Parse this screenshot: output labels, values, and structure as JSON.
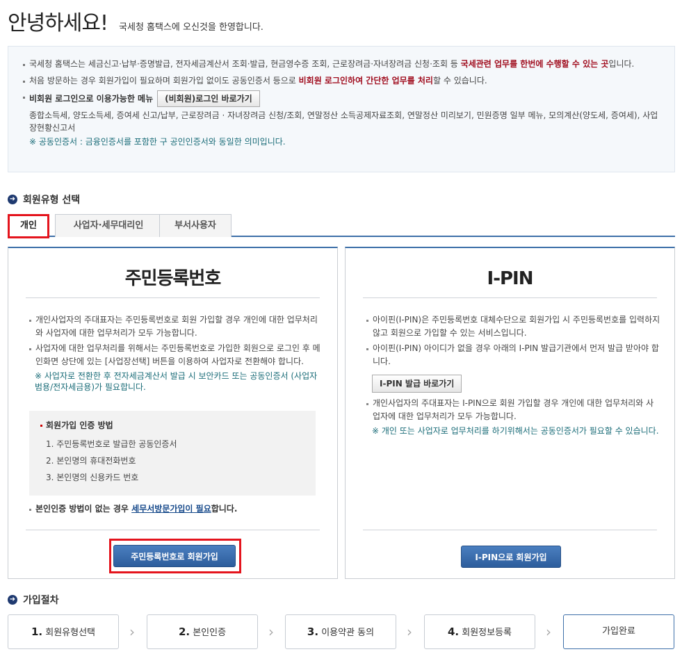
{
  "greeting": {
    "title": "안녕하세요!",
    "subtitle": "국세청 홈택스에 오신것을 한영합니다."
  },
  "info": {
    "line1_a": "국세청 홈택스는 세금신고·납부·증명발급, 전자세금계산서 조회·발급, 현금영수증 조회, 근로장려금·자녀장려금 신청·조회 등 ",
    "line1_b": "국세관련 업무를 한번에 수행할 수 있는 곳",
    "line1_c": "입니다.",
    "line2_a": "처음 방문하는 경우 회원가입이 필요하며 회원가입 없이도 공동인증서 등으로 ",
    "line2_b": "비회원 로그인하여 간단한 업무를 처리",
    "line2_c": "할 수 있습니다.",
    "menu_label": "비회원 로그인으로 이용가능한 메뉴",
    "menu_button": "(비회원)로그인 바로가기",
    "menu_list": "종합소득세, 양도소득세, 증여세 신고/납부, 근로장려금 · 자녀장려금 신청/조회, 연말정산 소득공제자료조회, 연말정산 미리보기, 민원증명 일부 메뉴, 모의계산(양도세, 증여세), 사업장현황신고서",
    "note": "※ 공동인증서 : 금융인증서를 포함한 구 공인인증서와 동일한 의미입니다."
  },
  "member_type": {
    "title": "회원유형 선택",
    "tabs": [
      "개인",
      "사업자·세무대리인",
      "부서사용자"
    ]
  },
  "left_card": {
    "title": "주민등록번호",
    "bullet1": "개인사업자의 주대표자는 주민등록번호로 회원 가입할 경우 개인에 대한 업무처리와 사업자에 대한 업무처리가 모두 가능합니다.",
    "bullet2": "사업자에 대한 업무처리를 위해서는 주민등록번호로 가입한 회원으로 로그인 후 메인화면 상단에 있는 [사업장선택] 버튼을 이용하여 사업자로 전환해야 합니다.",
    "note": "※ 사업자로 전환한 후 전자세금계산서 발급 시 보안카드 또는 공동인증서 (사업자범용/전자세금용)가 필요합니다.",
    "auth_title": "회원가입 인증 방법",
    "auth_items": [
      "1. 주민등록번호로 발급한 공동인증서",
      "2. 본인명의 휴대전화번호",
      "3. 본인명의 신용카드 번호"
    ],
    "bottom_a": "본인인증 방법이 없는 경우 ",
    "bottom_link": "세무서방문가입이 필요",
    "bottom_c": "합니다.",
    "button": "주민등록번호로 회원가입"
  },
  "right_card": {
    "title": "I-PIN",
    "bullet1": "아이핀(I-PIN)은 주민등록번호 대체수단으로 회원가입 시 주민등록번호를 입력하지 않고 회원으로 가입할 수 있는 서비스입니다.",
    "bullet2": "아이핀(I-PIN) 아이디가 없을 경우 아래의 I-PIN 발급기관에서 먼저 발급 받아야 합니다.",
    "issue_button": "I-PIN 발급 바로가기",
    "bullet3": "개인사업자의 주대표자는 I-PIN으로 회원 가입할 경우 개인에 대한 업무처리와 사업자에 대한 업무처리가 모두 가능합니다.",
    "note": "※ 개인 또는 사업자로 업무처리를 하기위해서는 공동인증서가 필요할 수 있습니다.",
    "button": "I-PIN으로 회원가입"
  },
  "process": {
    "title": "가입절차",
    "steps": [
      {
        "num": "1.",
        "label": "회원유형선택"
      },
      {
        "num": "2.",
        "label": "본인인증"
      },
      {
        "num": "3.",
        "label": "이용약관 동의"
      },
      {
        "num": "4.",
        "label": "회원정보등록"
      },
      {
        "num": "",
        "label": "가입완료"
      }
    ]
  },
  "colors": {
    "accent_blue": "#3d6fa8",
    "highlight_red": "#e4141d",
    "emphasis_red": "#a00d1e",
    "note_teal": "#1a6c78"
  }
}
